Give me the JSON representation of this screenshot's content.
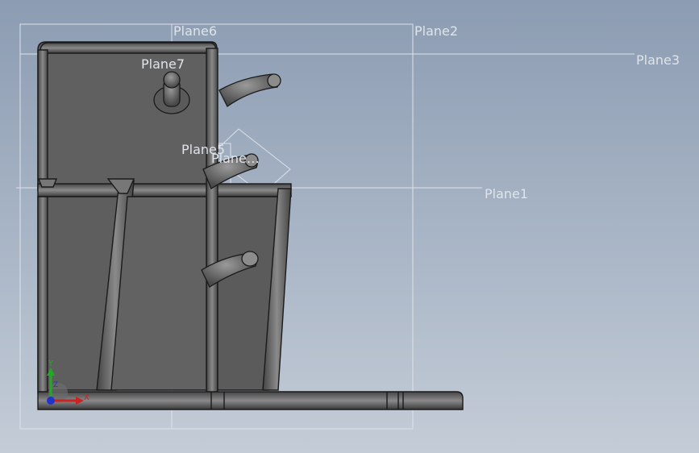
{
  "view": {
    "background_top": "#8c9cb2",
    "background_bottom": "#c4ccd7",
    "part_color": "#5f5f5f",
    "edge_color": "#1a1a1a",
    "plane_color": "#e2e7ee"
  },
  "planes": {
    "plane1": "Plane1",
    "plane2": "Plane2",
    "plane3": "Plane3",
    "plane5": "Plane5",
    "plane6": "Plane6",
    "plane7": "Plane7",
    "plane8": "Plane…"
  },
  "triad": {
    "x_label": "X",
    "y_label": "Y",
    "z_label": "Z",
    "x_color": "#cc2222",
    "y_color": "#22aa22",
    "z_color": "#2233cc"
  }
}
